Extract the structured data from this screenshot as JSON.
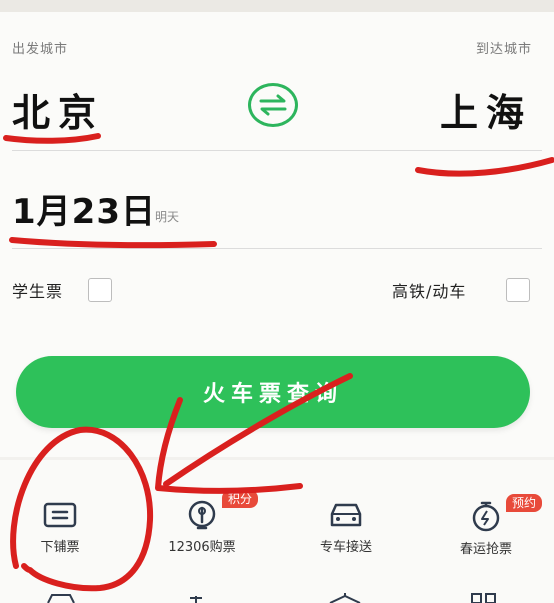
{
  "trip": {
    "from_label": "出发城市",
    "to_label": "到达城市",
    "from_city": "北京",
    "to_city": "上海",
    "date": "1月23日",
    "weekday": "明天"
  },
  "options": {
    "student_label": "学生票",
    "highspeed_label": "高铁/动车"
  },
  "search_button": "火车票查询",
  "services": [
    {
      "label": "下铺票",
      "icon": "ticket-icon"
    },
    {
      "label": "12306购票",
      "icon": "train-icon",
      "badge": "积分"
    },
    {
      "label": "专车接送",
      "icon": "car-icon"
    },
    {
      "label": "春运抢票",
      "icon": "stopwatch-icon",
      "badge": "预约"
    }
  ],
  "colors": {
    "accent": "#2ec15a",
    "annotation": "#d9201e"
  }
}
